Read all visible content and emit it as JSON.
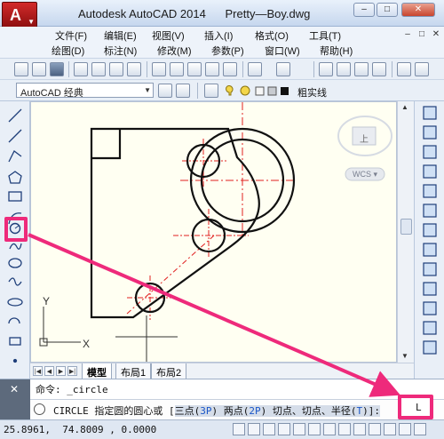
{
  "window": {
    "title": "Autodesk AutoCAD 2014      Pretty—Boy.dwg",
    "controls": {
      "minimize": "–",
      "maximize": "□",
      "close": "✕"
    }
  },
  "menubar": {
    "row1": [
      "文件(F)",
      "编辑(E)",
      "视图(V)",
      "插入(I)",
      "格式(O)",
      "工具(T)"
    ],
    "row2": [
      "绘图(D)",
      "标注(N)",
      "修改(M)",
      "参数(P)",
      "窗口(W)",
      "帮助(H)"
    ]
  },
  "toolbar2": {
    "workspace": "AutoCAD 经典",
    "linetype_label": "粗实线"
  },
  "viewcube": {
    "label": "上",
    "wcs": "WCS ▾"
  },
  "ucs": {
    "x_label": "X",
    "y_label": "Y"
  },
  "layout_tabs": [
    "模型",
    "布局1",
    "布局2"
  ],
  "command": {
    "history": "命令: _circle",
    "prompt_main": "CIRCLE 指定圆的圆心或 [",
    "opt1": "三点(",
    "opt1_key": "3P",
    "opt1_end": ")",
    "opt2": " 两点(",
    "opt2_key": "2P",
    "opt2_end": ")",
    "opt3": " 切点、切点、半径(",
    "opt3_key": "T",
    "opt3_end": ")]:",
    "cursor": "L"
  },
  "status": {
    "coords": "25.8961,  74.8009 , 0.0000"
  },
  "colors": {
    "highlight": "#ee2a7b",
    "crosshair": "#e02020",
    "canvas_bg": "#fffff2"
  },
  "annotations": {
    "highlight_targets": [
      "circle-tool-button",
      "command-input-cursor"
    ]
  }
}
